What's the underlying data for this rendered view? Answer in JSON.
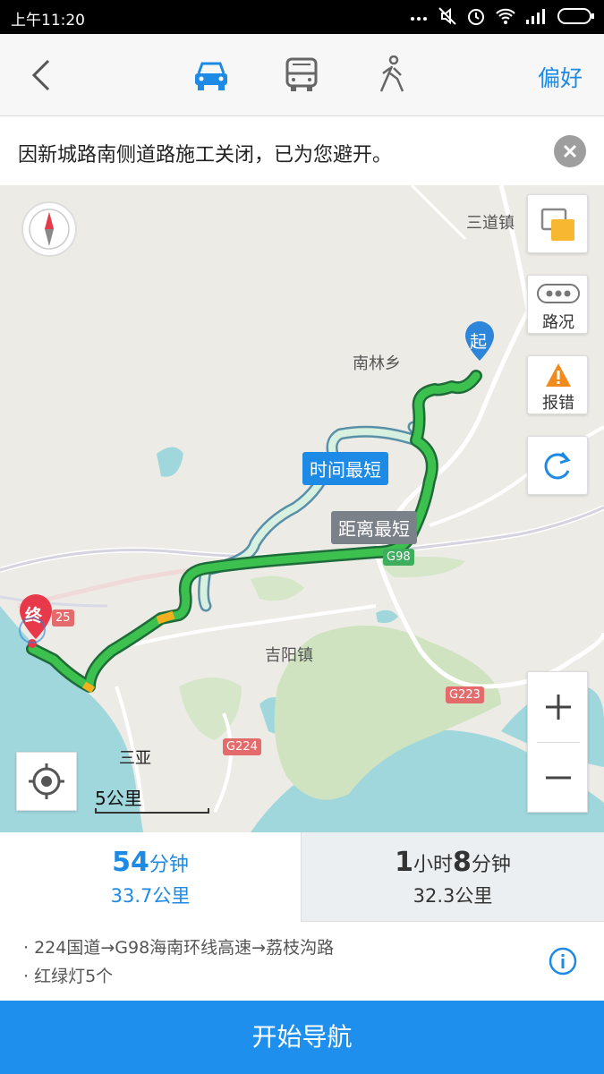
{
  "status_bar": {
    "time": "上午11:20"
  },
  "header": {
    "preference_label": "偏好",
    "active_mode": "car"
  },
  "notice": {
    "text": "因新城路南侧道路施工关闭，已为您避开。"
  },
  "map": {
    "places": {
      "sandao": "三道镇",
      "nanlin": "南林乡",
      "jiyang": "吉阳镇",
      "sanya": "三亚"
    },
    "roads": {
      "g98": "G98",
      "g223": "G223",
      "g224": "G224",
      "g225": "25"
    },
    "route_tags": {
      "time_shortest": "时间最短",
      "distance_shortest": "距离最短"
    },
    "markers": {
      "start": "起",
      "end": "终"
    },
    "buttons": {
      "traffic": "路况",
      "report": "报错"
    },
    "scale": "5公里"
  },
  "routes": [
    {
      "h": "",
      "h_unit": "",
      "m": "54",
      "m_unit": "分钟",
      "distance": "33.7公里",
      "selected": true
    },
    {
      "h": "1",
      "h_unit": "小时",
      "m": "8",
      "m_unit": "分钟",
      "distance": "32.3公里",
      "selected": false
    }
  ],
  "route_info": {
    "path": "224国道→G98海南环线高速→荔枝沟路",
    "traffic_lights": "红绿灯5个"
  },
  "start_navigation": "开始导航",
  "colors": {
    "accent": "#1e8fec",
    "route_green": "#2fb44a",
    "tag_blue": "#1d8ae6",
    "marker_red": "#e8394a"
  }
}
